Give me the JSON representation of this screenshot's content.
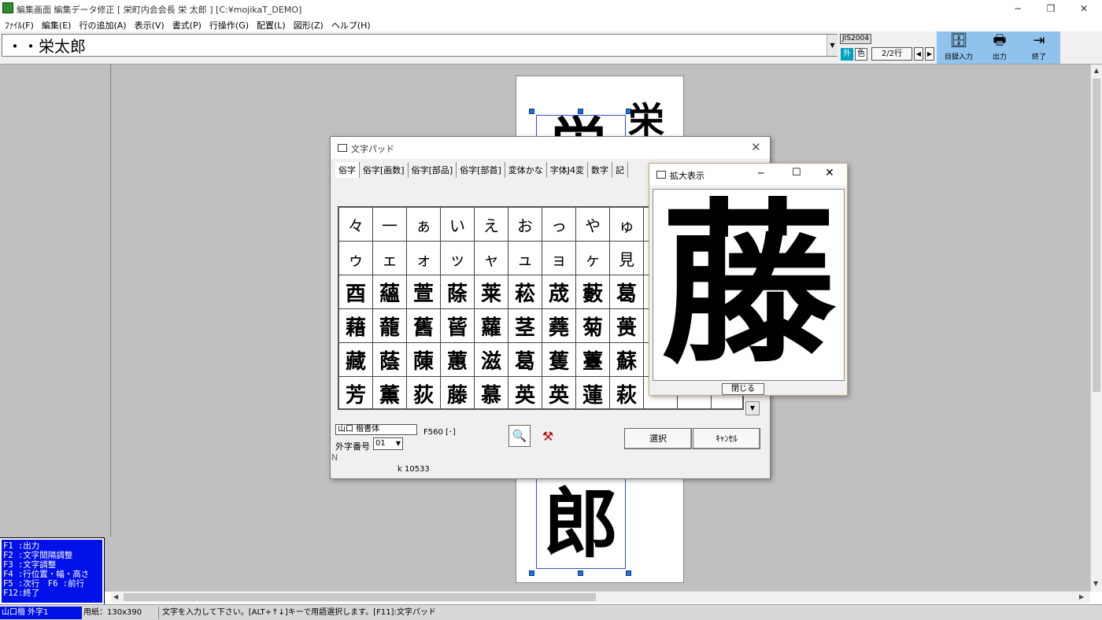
{
  "window": {
    "title": "編集画面 編集データ修正 [ 栄町内会会長 栄 太郎 ] [C:¥mojikaT_DEMO]",
    "minimize": "─",
    "maximize": "❐",
    "close": "✕"
  },
  "menu": [
    "ﾌｧｲﾙ(F)",
    "編集(E)",
    "行の追加(A)",
    "表示(V)",
    "書式(P)",
    "行操作(G)",
    "配置(L)",
    "図形(Z)",
    "ヘルプ(H)"
  ],
  "toolbar": {
    "input_value": "・・栄太郎",
    "jis": "JIS2004",
    "gai": "外",
    "iro": "色",
    "row_indicator": "2/2行",
    "prev": "◀",
    "next": "▶",
    "buttons": [
      {
        "label": "目録入力",
        "icon_name": "catalog-icon"
      },
      {
        "label": "出力",
        "icon_name": "printer-icon"
      },
      {
        "label": "終了",
        "icon_name": "exit-icon"
      }
    ]
  },
  "page": {
    "char_top_right": "栄",
    "char_top_partial": "栄",
    "char_bottom": "郎"
  },
  "help": {
    "lines": [
      "F1 :出力",
      "F2 :文字間隔調整",
      "F3 :文字調整",
      "F4 :行位置・幅・高さ",
      "F5 :次行　F6 :前行",
      "F12:終了"
    ]
  },
  "status": {
    "font": "山口楷 外字1",
    "paper": "用紙：130x390",
    "message": "文字を入力して下さい。[ALT+↑↓]キーで用語選択します。[F11]:文字パッド"
  },
  "pad": {
    "title": "文字パッド",
    "tabs": [
      "俗字",
      "俗字[画数]",
      "俗字[部品]",
      "俗字[部首]",
      "変体かな",
      "字体J4変",
      "数字",
      "記"
    ],
    "grid": [
      [
        "々",
        "一",
        "ぁ",
        "い",
        "え",
        "お",
        "っ",
        "や",
        "ゅ",
        "",
        "",
        ""
      ],
      [
        "ゥ",
        "ェ",
        "ォ",
        "ッ",
        "ャ",
        "ュ",
        "ョ",
        "ヶ",
        "見",
        "",
        "",
        ""
      ],
      [
        "酉",
        "蘊",
        "萱",
        "蒢",
        "莱",
        "菘",
        "荿",
        "藪",
        "葛",
        "",
        "",
        ""
      ],
      [
        "藉",
        "蘢",
        "舊",
        "蒈",
        "蘿",
        "茎",
        "蕘",
        "菊",
        "蒉",
        "",
        "",
        ""
      ],
      [
        "藏",
        "蔭",
        "蔯",
        "蕙",
        "滋",
        "葛",
        "蒦",
        "薹",
        "蘇",
        "",
        "",
        ""
      ],
      [
        "芳",
        "薫",
        "荻",
        "藤",
        "慕",
        "英",
        "英",
        "蓮",
        "萩",
        "",
        "",
        ""
      ]
    ],
    "font_name": "山口 楷書体",
    "f_code": "F560 [･]",
    "gaiji_label": "外字番号",
    "gaiji_value": "01",
    "n_label": "N",
    "k_code": "k 10533",
    "select_label": "選択",
    "cancel_label": "ｷｬﾝｾﾙ",
    "close": "✕"
  },
  "zoom": {
    "title": "拡大表示",
    "char": "藤",
    "close_button": "閉じる",
    "minimize": "─",
    "maximize": "☐",
    "close": "✕"
  }
}
